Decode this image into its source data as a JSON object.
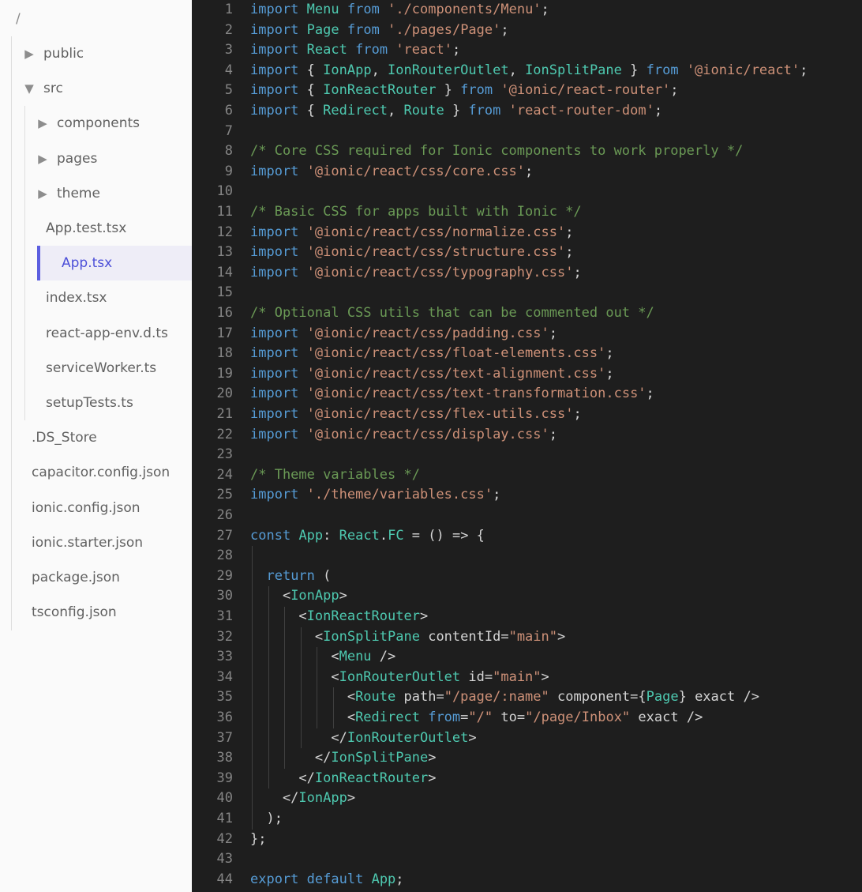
{
  "sidebar": {
    "root_label": "/",
    "items": [
      {
        "label": "public",
        "type": "folder",
        "expanded": false,
        "depth": 0
      },
      {
        "label": "src",
        "type": "folder",
        "expanded": true,
        "depth": 0
      },
      {
        "label": "components",
        "type": "folder",
        "expanded": false,
        "depth": 1
      },
      {
        "label": "pages",
        "type": "folder",
        "expanded": false,
        "depth": 1
      },
      {
        "label": "theme",
        "type": "folder",
        "expanded": false,
        "depth": 1
      },
      {
        "label": "App.test.tsx",
        "type": "file",
        "depth": 1
      },
      {
        "label": "App.tsx",
        "type": "file",
        "depth": 1,
        "selected": true
      },
      {
        "label": "index.tsx",
        "type": "file",
        "depth": 1
      },
      {
        "label": "react-app-env.d.ts",
        "type": "file",
        "depth": 1
      },
      {
        "label": "serviceWorker.ts",
        "type": "file",
        "depth": 1
      },
      {
        "label": "setupTests.ts",
        "type": "file",
        "depth": 1
      },
      {
        "label": ".DS_Store",
        "type": "file",
        "depth": 0
      },
      {
        "label": "capacitor.config.json",
        "type": "file",
        "depth": 0
      },
      {
        "label": "ionic.config.json",
        "type": "file",
        "depth": 0
      },
      {
        "label": "ionic.starter.json",
        "type": "file",
        "depth": 0
      },
      {
        "label": "package.json",
        "type": "file",
        "depth": 0
      },
      {
        "label": "tsconfig.json",
        "type": "file",
        "depth": 0
      }
    ],
    "icons": {
      "collapsed": "caret-right-icon",
      "expanded": "caret-down-icon"
    },
    "colors": {
      "selected_accent": "#5c5fe0",
      "selected_text": "#4c4fd8"
    }
  },
  "editor": {
    "lines": [
      [
        [
          "k",
          "import"
        ],
        [
          "p",
          " "
        ],
        [
          "i",
          "Menu"
        ],
        [
          "p",
          " "
        ],
        [
          "k",
          "from"
        ],
        [
          "p",
          " "
        ],
        [
          "s",
          "'./components/Menu'"
        ],
        [
          "p",
          ";"
        ]
      ],
      [
        [
          "k",
          "import"
        ],
        [
          "p",
          " "
        ],
        [
          "i",
          "Page"
        ],
        [
          "p",
          " "
        ],
        [
          "k",
          "from"
        ],
        [
          "p",
          " "
        ],
        [
          "s",
          "'./pages/Page'"
        ],
        [
          "p",
          ";"
        ]
      ],
      [
        [
          "k",
          "import"
        ],
        [
          "p",
          " "
        ],
        [
          "i",
          "React"
        ],
        [
          "p",
          " "
        ],
        [
          "k",
          "from"
        ],
        [
          "p",
          " "
        ],
        [
          "s",
          "'react'"
        ],
        [
          "p",
          ";"
        ]
      ],
      [
        [
          "k",
          "import"
        ],
        [
          "p",
          " { "
        ],
        [
          "i",
          "IonApp"
        ],
        [
          "p",
          ", "
        ],
        [
          "i",
          "IonRouterOutlet"
        ],
        [
          "p",
          ", "
        ],
        [
          "i",
          "IonSplitPane"
        ],
        [
          "p",
          " } "
        ],
        [
          "k",
          "from"
        ],
        [
          "p",
          " "
        ],
        [
          "s",
          "'@ionic/react'"
        ],
        [
          "p",
          ";"
        ]
      ],
      [
        [
          "k",
          "import"
        ],
        [
          "p",
          " { "
        ],
        [
          "i",
          "IonReactRouter"
        ],
        [
          "p",
          " } "
        ],
        [
          "k",
          "from"
        ],
        [
          "p",
          " "
        ],
        [
          "s",
          "'@ionic/react-router'"
        ],
        [
          "p",
          ";"
        ]
      ],
      [
        [
          "k",
          "import"
        ],
        [
          "p",
          " { "
        ],
        [
          "i",
          "Redirect"
        ],
        [
          "p",
          ", "
        ],
        [
          "i",
          "Route"
        ],
        [
          "p",
          " } "
        ],
        [
          "k",
          "from"
        ],
        [
          "p",
          " "
        ],
        [
          "s",
          "'react-router-dom'"
        ],
        [
          "p",
          ";"
        ]
      ],
      [],
      [
        [
          "c",
          "/* Core CSS required for Ionic components to work properly */"
        ]
      ],
      [
        [
          "k",
          "import"
        ],
        [
          "p",
          " "
        ],
        [
          "s",
          "'@ionic/react/css/core.css'"
        ],
        [
          "p",
          ";"
        ]
      ],
      [],
      [
        [
          "c",
          "/* Basic CSS for apps built with Ionic */"
        ]
      ],
      [
        [
          "k",
          "import"
        ],
        [
          "p",
          " "
        ],
        [
          "s",
          "'@ionic/react/css/normalize.css'"
        ],
        [
          "p",
          ";"
        ]
      ],
      [
        [
          "k",
          "import"
        ],
        [
          "p",
          " "
        ],
        [
          "s",
          "'@ionic/react/css/structure.css'"
        ],
        [
          "p",
          ";"
        ]
      ],
      [
        [
          "k",
          "import"
        ],
        [
          "p",
          " "
        ],
        [
          "s",
          "'@ionic/react/css/typography.css'"
        ],
        [
          "p",
          ";"
        ]
      ],
      [],
      [
        [
          "c",
          "/* Optional CSS utils that can be commented out */"
        ]
      ],
      [
        [
          "k",
          "import"
        ],
        [
          "p",
          " "
        ],
        [
          "s",
          "'@ionic/react/css/padding.css'"
        ],
        [
          "p",
          ";"
        ]
      ],
      [
        [
          "k",
          "import"
        ],
        [
          "p",
          " "
        ],
        [
          "s",
          "'@ionic/react/css/float-elements.css'"
        ],
        [
          "p",
          ";"
        ]
      ],
      [
        [
          "k",
          "import"
        ],
        [
          "p",
          " "
        ],
        [
          "s",
          "'@ionic/react/css/text-alignment.css'"
        ],
        [
          "p",
          ";"
        ]
      ],
      [
        [
          "k",
          "import"
        ],
        [
          "p",
          " "
        ],
        [
          "s",
          "'@ionic/react/css/text-transformation.css'"
        ],
        [
          "p",
          ";"
        ]
      ],
      [
        [
          "k",
          "import"
        ],
        [
          "p",
          " "
        ],
        [
          "s",
          "'@ionic/react/css/flex-utils.css'"
        ],
        [
          "p",
          ";"
        ]
      ],
      [
        [
          "k",
          "import"
        ],
        [
          "p",
          " "
        ],
        [
          "s",
          "'@ionic/react/css/display.css'"
        ],
        [
          "p",
          ";"
        ]
      ],
      [],
      [
        [
          "c",
          "/* Theme variables */"
        ]
      ],
      [
        [
          "k",
          "import"
        ],
        [
          "p",
          " "
        ],
        [
          "s",
          "'./theme/variables.css'"
        ],
        [
          "p",
          ";"
        ]
      ],
      [],
      [
        [
          "k",
          "const"
        ],
        [
          "p",
          " "
        ],
        [
          "i",
          "App"
        ],
        [
          "p",
          ": "
        ],
        [
          "i",
          "React"
        ],
        [
          "p",
          "."
        ],
        [
          "i",
          "FC"
        ],
        [
          "p",
          " = () => {"
        ]
      ],
      [],
      [
        [
          "p",
          "  "
        ],
        [
          "k",
          "return"
        ],
        [
          "p",
          " ("
        ]
      ],
      [
        [
          "p",
          "    <"
        ],
        [
          "tg",
          "IonApp"
        ],
        [
          "p",
          ">"
        ]
      ],
      [
        [
          "p",
          "      <"
        ],
        [
          "tg",
          "IonReactRouter"
        ],
        [
          "p",
          ">"
        ]
      ],
      [
        [
          "p",
          "        <"
        ],
        [
          "tg",
          "IonSplitPane"
        ],
        [
          "p",
          " "
        ],
        [
          "at",
          "contentId"
        ],
        [
          "p",
          "="
        ],
        [
          "s",
          "\"main\""
        ],
        [
          "p",
          ">"
        ]
      ],
      [
        [
          "p",
          "          <"
        ],
        [
          "tg",
          "Menu"
        ],
        [
          "p",
          " />"
        ]
      ],
      [
        [
          "p",
          "          <"
        ],
        [
          "tg",
          "IonRouterOutlet"
        ],
        [
          "p",
          " "
        ],
        [
          "at",
          "id"
        ],
        [
          "p",
          "="
        ],
        [
          "s",
          "\"main\""
        ],
        [
          "p",
          ">"
        ]
      ],
      [
        [
          "p",
          "            <"
        ],
        [
          "tg",
          "Route"
        ],
        [
          "p",
          " "
        ],
        [
          "at",
          "path"
        ],
        [
          "p",
          "="
        ],
        [
          "s",
          "\"/page/:name\""
        ],
        [
          "p",
          " "
        ],
        [
          "at",
          "component"
        ],
        [
          "p",
          "={"
        ],
        [
          "tg",
          "Page"
        ],
        [
          "p",
          "} "
        ],
        [
          "at",
          "exact"
        ],
        [
          "p",
          " />"
        ]
      ],
      [
        [
          "p",
          "            <"
        ],
        [
          "tg",
          "Redirect"
        ],
        [
          "p",
          " "
        ],
        [
          "k",
          "from"
        ],
        [
          "p",
          "="
        ],
        [
          "s",
          "\"/\""
        ],
        [
          "p",
          " "
        ],
        [
          "at",
          "to"
        ],
        [
          "p",
          "="
        ],
        [
          "s",
          "\"/page/Inbox\""
        ],
        [
          "p",
          " "
        ],
        [
          "at",
          "exact"
        ],
        [
          "p",
          " />"
        ]
      ],
      [
        [
          "p",
          "          </"
        ],
        [
          "tg",
          "IonRouterOutlet"
        ],
        [
          "p",
          ">"
        ]
      ],
      [
        [
          "p",
          "        </"
        ],
        [
          "tg",
          "IonSplitPane"
        ],
        [
          "p",
          ">"
        ]
      ],
      [
        [
          "p",
          "      </"
        ],
        [
          "tg",
          "IonReactRouter"
        ],
        [
          "p",
          ">"
        ]
      ],
      [
        [
          "p",
          "    </"
        ],
        [
          "tg",
          "IonApp"
        ],
        [
          "p",
          ">"
        ]
      ],
      [
        [
          "p",
          "  );"
        ]
      ],
      [
        [
          "p",
          "};"
        ]
      ],
      [],
      [
        [
          "k",
          "export"
        ],
        [
          "p",
          " "
        ],
        [
          "k",
          "default"
        ],
        [
          "p",
          " "
        ],
        [
          "i",
          "App"
        ],
        [
          "p",
          ";"
        ]
      ]
    ],
    "colors": {
      "background": "#1e1e1e",
      "keyword": "#569cd6",
      "type": "#4ec9b0",
      "string": "#ce9178",
      "comment": "#6a9955",
      "text": "#d4d4d4",
      "line_number": "#858585"
    }
  }
}
